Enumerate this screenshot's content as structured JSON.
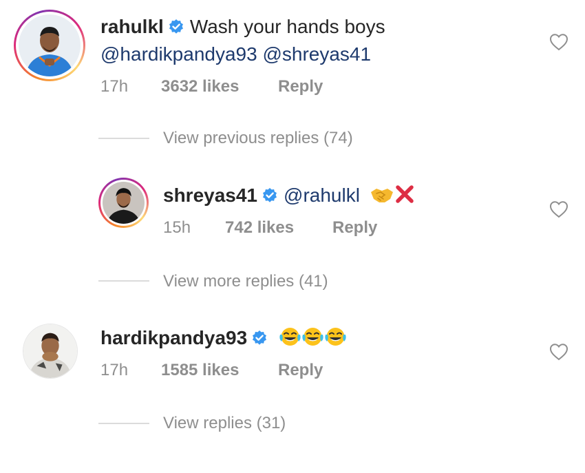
{
  "comments": [
    {
      "username": "rahulkl",
      "text": "Wash your hands boys",
      "mentions": "@hardikpandya93 @shreyas41",
      "time": "17h",
      "likes": "3632 likes",
      "reply": "Reply",
      "verified": true,
      "liked": false
    },
    {
      "username": "shreyas41",
      "mention": "@rahulkl",
      "emojis": [
        "handshake-emoji",
        "cross-mark-emoji"
      ],
      "time": "15h",
      "likes": "742 likes",
      "reply": "Reply",
      "verified": true,
      "liked": false
    },
    {
      "username": "hardikpandya93",
      "emojis": [
        "tears-of-joy-emoji",
        "tears-of-joy-emoji",
        "tears-of-joy-emoji"
      ],
      "time": "17h",
      "likes": "1585 likes",
      "reply": "Reply",
      "verified": true,
      "liked": false
    }
  ],
  "view_links": {
    "previous": "View previous replies (74)",
    "more": "View more replies (41)",
    "replies": "View replies (31)"
  },
  "colors": {
    "verified_blue": "#3897f0",
    "meta_gray": "#8e8e8e",
    "mention_navy": "#1e3a6d",
    "divider": "#dbdbdb"
  }
}
